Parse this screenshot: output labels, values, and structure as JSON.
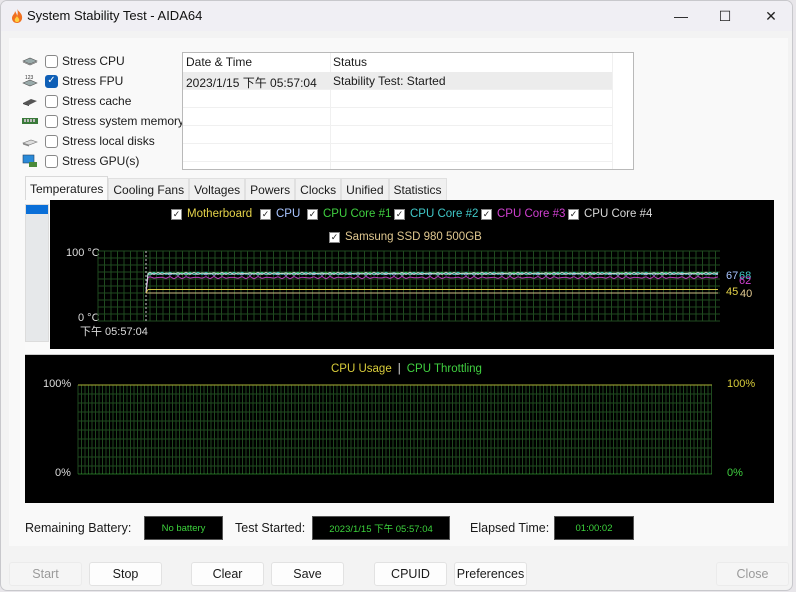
{
  "window": {
    "title": "System Stability Test - AIDA64",
    "controls": {
      "minimize": "—",
      "maximize": "☐",
      "close": "✕"
    }
  },
  "stress_options": [
    {
      "label": "Stress CPU",
      "checked": false,
      "icon": "cpu-chip-icon"
    },
    {
      "label": "Stress FPU",
      "checked": true,
      "icon": "fpu-chip-icon"
    },
    {
      "label": "Stress cache",
      "checked": false,
      "icon": "cache-icon"
    },
    {
      "label": "Stress system memory",
      "checked": false,
      "icon": "memory-module-icon"
    },
    {
      "label": "Stress local disks",
      "checked": false,
      "icon": "disk-drive-icon"
    },
    {
      "label": "Stress GPU(s)",
      "checked": false,
      "icon": "gpu-monitor-icon"
    }
  ],
  "log": {
    "columns": [
      "Date & Time",
      "Status"
    ],
    "rows": [
      {
        "date": "2023/1/15 下午 05:57:04",
        "status": "Stability Test: Started"
      }
    ]
  },
  "tabs": [
    {
      "label": "Temperatures",
      "active": true
    },
    {
      "label": "Cooling Fans",
      "active": false
    },
    {
      "label": "Voltages",
      "active": false
    },
    {
      "label": "Powers",
      "active": false
    },
    {
      "label": "Clocks",
      "active": false
    },
    {
      "label": "Unified",
      "active": false
    },
    {
      "label": "Statistics",
      "active": false
    }
  ],
  "chart_data": [
    {
      "type": "line",
      "title": "Temperatures",
      "legend": [
        {
          "name": "Motherboard",
          "checked": true,
          "color": "#e6d44a"
        },
        {
          "name": "CPU",
          "checked": true,
          "color": "#a8c4ff"
        },
        {
          "name": "CPU Core #1",
          "checked": true,
          "color": "#40d040"
        },
        {
          "name": "CPU Core #2",
          "checked": true,
          "color": "#40c8c8"
        },
        {
          "name": "CPU Core #3",
          "checked": true,
          "color": "#d040d0"
        },
        {
          "name": "CPU Core #4",
          "checked": true,
          "color": "#d8d8d8"
        },
        {
          "name": "Samsung SSD 980 500GB",
          "checked": true,
          "color": "#e0c890"
        }
      ],
      "ylim": [
        0,
        100
      ],
      "y_top_label": "100 °C",
      "y_bottom_label": "0 °C",
      "x_start_label": "下午 05:57:04",
      "grid": true,
      "series": [
        {
          "name": "CPU",
          "current": 67
        },
        {
          "name": "CPU Core #1",
          "current": 68
        },
        {
          "name": "CPU Core #2",
          "current": 68
        },
        {
          "name": "CPU Core #3",
          "current": 62
        },
        {
          "name": "CPU Core #4",
          "current": 68
        },
        {
          "name": "Motherboard",
          "current": 45
        },
        {
          "name": "Samsung SSD 980 500GB",
          "current": 40
        }
      ],
      "value_labels": [
        {
          "text": "67",
          "color": "#a8c4ff"
        },
        {
          "text": "68",
          "color": "#40c8c8"
        },
        {
          "text": "62",
          "color": "#d040d0"
        },
        {
          "text": "45",
          "color": "#e6d44a"
        },
        {
          "text": "40",
          "color": "#e0c890"
        }
      ]
    },
    {
      "type": "line",
      "title": "CPU Usage | CPU Throttling",
      "legend": [
        {
          "name": "CPU Usage",
          "color": "#d8cc3a"
        },
        {
          "name": "CPU Throttling",
          "color": "#40d040"
        }
      ],
      "separator": "|",
      "ylim": [
        0,
        100
      ],
      "left_labels": {
        "top": "100%",
        "bottom": "0%"
      },
      "right_labels": {
        "top": "100%",
        "bottom": "0%"
      },
      "grid": true,
      "series": [
        {
          "name": "CPU Usage",
          "current": 100
        },
        {
          "name": "CPU Throttling",
          "current": 0
        }
      ]
    }
  ],
  "status": {
    "battery_label": "Remaining Battery:",
    "battery_value": "No battery",
    "started_label": "Test Started:",
    "started_value": "2023/1/15 下午 05:57:04",
    "elapsed_label": "Elapsed Time:",
    "elapsed_value": "01:00:02"
  },
  "buttons": {
    "start": "Start",
    "stop": "Stop",
    "clear": "Clear",
    "save": "Save",
    "cpuid": "CPUID",
    "preferences": "Preferences",
    "close": "Close"
  }
}
